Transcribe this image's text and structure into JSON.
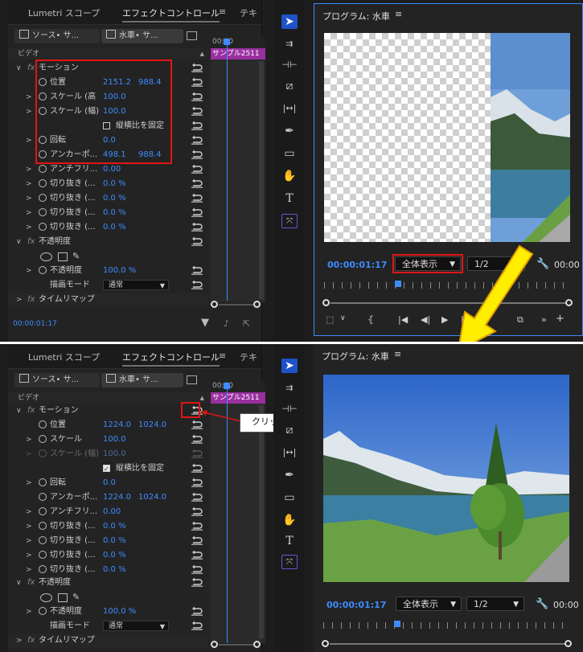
{
  "tabs": {
    "lumetri": "Lumetri スコープ",
    "effect_controls": "エフェクトコントロール",
    "overflow": "テキ"
  },
  "source_chip": "ソース• サ...",
  "sequence_chip": "水車• サ...",
  "video_section": "ビデオ",
  "timeline_clip": "サンプル2511",
  "ruler_time": "00:00",
  "motion_label": "モーション",
  "opacity_section": "不透明度",
  "time_remap": "タイムリマップ",
  "blend_mode_label": "描画モード",
  "blend_mode_value": "通常",
  "ec_timecode": "00:00:01:17",
  "program_title": "プログラム: 水車",
  "program_timecode": "00:00:01:17",
  "zoom_select": "全体表示",
  "resolution_select": "1/2",
  "program_timecode_right": "00:00",
  "callout_text": "クリック",
  "before": {
    "position": {
      "label": "位置",
      "x": "2151.2",
      "y": "988.4"
    },
    "scale_h": {
      "label": "スケール (高",
      "value": "100.0"
    },
    "scale_w": {
      "label": "スケール (幅)",
      "value": "100.0"
    },
    "uniform_scale": {
      "label": "縦横比を固定",
      "checked": false
    },
    "rotation": {
      "label": "回転",
      "value": "0.0"
    },
    "anchor": {
      "label": "アンカーポ...",
      "x": "498.1",
      "y": "988.4"
    },
    "anti_flicker": {
      "label": "アンチフリ...",
      "value": "0.00"
    },
    "crop": [
      {
        "label": "切り抜き (...",
        "value": "0.0 %"
      },
      {
        "label": "切り抜き (...",
        "value": "0.0 %"
      },
      {
        "label": "切り抜き (...",
        "value": "0.0 %"
      },
      {
        "label": "切り抜き (...",
        "value": "0.0 %"
      }
    ],
    "opacity": {
      "label": "不透明度",
      "value": "100.0 %"
    }
  },
  "after": {
    "position": {
      "label": "位置",
      "x": "1224.0",
      "y": "1024.0"
    },
    "scale": {
      "label": "スケール",
      "value": "100.0"
    },
    "scale_w": {
      "label": "スケール (幅)",
      "value": "100.0"
    },
    "uniform_scale": {
      "label": "縦横比を固定",
      "checked": true
    },
    "rotation": {
      "label": "回転",
      "value": "0.0"
    },
    "anchor": {
      "label": "アンカーポ...",
      "x": "1224.0",
      "y": "1024.0"
    },
    "anti_flicker": {
      "label": "アンチフリ...",
      "value": "0.00"
    },
    "crop": [
      {
        "label": "切り抜き (...",
        "value": "0.0 %"
      },
      {
        "label": "切り抜き (...",
        "value": "0.0 %"
      },
      {
        "label": "切り抜き (...",
        "value": "0.0 %"
      },
      {
        "label": "切り抜き (...",
        "value": "0.0 %"
      }
    ],
    "opacity": {
      "label": "不透明度",
      "value": "100.0 %"
    }
  },
  "colors": {
    "accent": "#3d8cff",
    "clip": "#9a2fa0",
    "highlight": "#e01515",
    "arrow": "#ffee00"
  }
}
